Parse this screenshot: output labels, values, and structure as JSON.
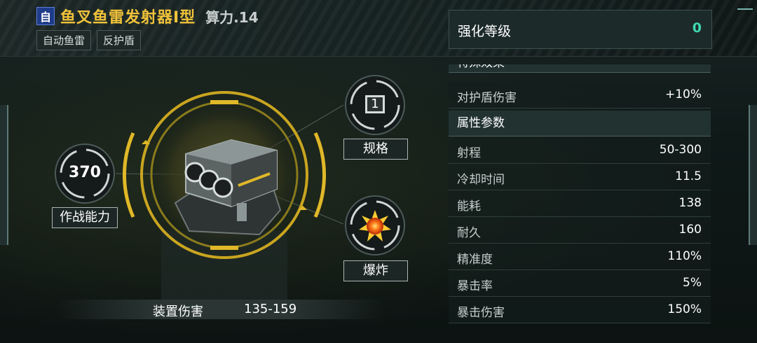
{
  "header": {
    "badge": "自",
    "weapon_name": "鱼叉鱼雷发射器Ⅰ型",
    "power": "算力.14",
    "tags": [
      "自动鱼雷",
      "反护盾"
    ]
  },
  "enhance": {
    "label": "强化等级",
    "value": "0"
  },
  "combat_power": {
    "value": "370",
    "label": "作战能力"
  },
  "spec": {
    "value": "1",
    "label": "规格"
  },
  "explosion": {
    "label": "爆炸",
    "icon": "explosion-icon"
  },
  "device_damage": {
    "label": "装置伤害",
    "value": "135-159"
  },
  "special_effects": {
    "title": "特殊效果",
    "rows": [
      {
        "key": "对护盾伤害",
        "value": "+10%"
      }
    ]
  },
  "attributes": {
    "title": "属性参数",
    "rows": [
      {
        "key": "射程",
        "value": "50-300"
      },
      {
        "key": "冷却时间",
        "value": "11.5"
      },
      {
        "key": "能耗",
        "value": "138"
      },
      {
        "key": "耐久",
        "value": "160"
      },
      {
        "key": "精准度",
        "value": "110%"
      },
      {
        "key": "暴击率",
        "value": "5%"
      },
      {
        "key": "暴击伤害",
        "value": "150%"
      }
    ]
  },
  "colors": {
    "accent_gold": "#f0c23a",
    "enhance_teal": "#3fd8b0",
    "badge_blue": "#1f3c8a"
  }
}
